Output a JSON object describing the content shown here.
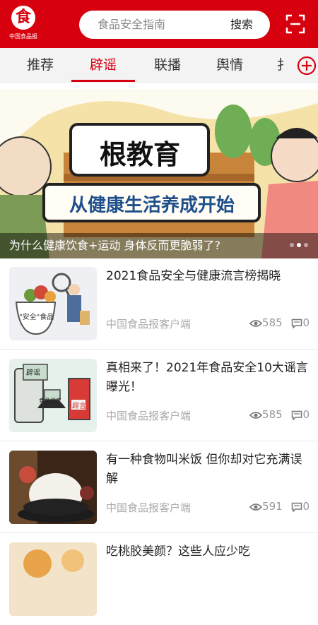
{
  "header": {
    "logo_glyph": "食",
    "logo_text": "中国食品报",
    "search_placeholder": "食品安全指南",
    "search_button": "搜索"
  },
  "tabs": [
    {
      "label": "推荐",
      "active": false
    },
    {
      "label": "辟谣",
      "active": true
    },
    {
      "label": "联播",
      "active": false
    },
    {
      "label": "舆情",
      "active": false
    },
    {
      "label": "扌",
      "active": false
    }
  ],
  "banner": {
    "sign_top": "根教育",
    "sign_bottom": "从健康生活养成开始",
    "caption": "为什么健康饮食+运动 身体反而更脆弱了?"
  },
  "articles": [
    {
      "title": "2021食品安全与健康流言榜揭晓",
      "source": "中国食品报客户端",
      "views": "585",
      "comments": "0",
      "thumb_label": "\"安全\"食品",
      "icon": "magnifier-illustration"
    },
    {
      "title": "真相来了！2021年食品安全10大谣言曝光！",
      "source": "中国食品报客户端",
      "views": "585",
      "comments": "0",
      "thumb_label_1": "辟谣",
      "thumb_label_2": "食品谣言",
      "thumb_label_3": "辟言",
      "icon": "rumor-illustration"
    },
    {
      "title": "有一种食物叫米饭 但你却对它充满误解",
      "source": "中国食品报客户端",
      "views": "591",
      "comments": "0",
      "icon": "rice-bowl-photo"
    },
    {
      "title": "吃桃胶美颜？这些人应少吃",
      "source": "",
      "views": "",
      "comments": "",
      "icon": "peach-gum-photo"
    }
  ],
  "colors": {
    "brand": "#d7000f",
    "tab_bg": "#f3f3f3",
    "muted": "#aaaaaa"
  }
}
